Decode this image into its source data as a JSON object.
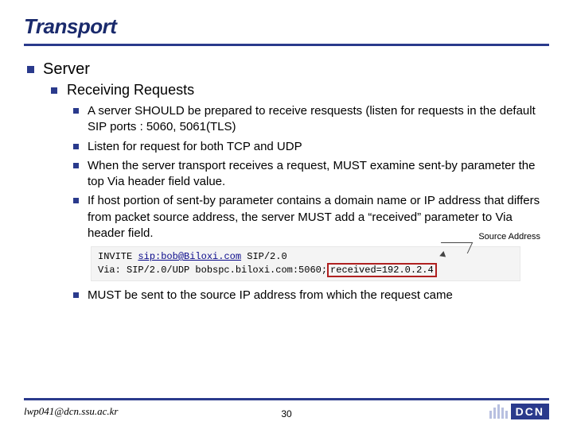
{
  "title": "Transport",
  "content": {
    "l1": "Server",
    "l2": "Receiving Requests",
    "l3": [
      "A server SHOULD be prepared to receive resquests (listen for requests in the default SIP ports : 5060, 5061(TLS)",
      "Listen for request for both TCP and UDP",
      "When the server transport receives a request, MUST examine sent-by parameter the top Via header field value.",
      "If host portion of sent-by parameter contains a domain name or IP address that differs from packet source address, the server MUST add a “received” parameter to Via header field."
    ],
    "l3_last": "MUST  be sent to the source IP address from which the request came"
  },
  "code": {
    "line1_pre": "INVITE ",
    "line1_link": "sip:bob@Biloxi.com",
    "line1_post": " SIP/2.0",
    "line2_pre": "Via: SIP/2.0/UDP bobspc.biloxi.com:5060;",
    "line2_box": "received=192.0.2.4",
    "source_label": "Source Address"
  },
  "footer": {
    "email": "lwp041@dcn.ssu.ac.kr",
    "page": "30",
    "logo": "DCN"
  }
}
